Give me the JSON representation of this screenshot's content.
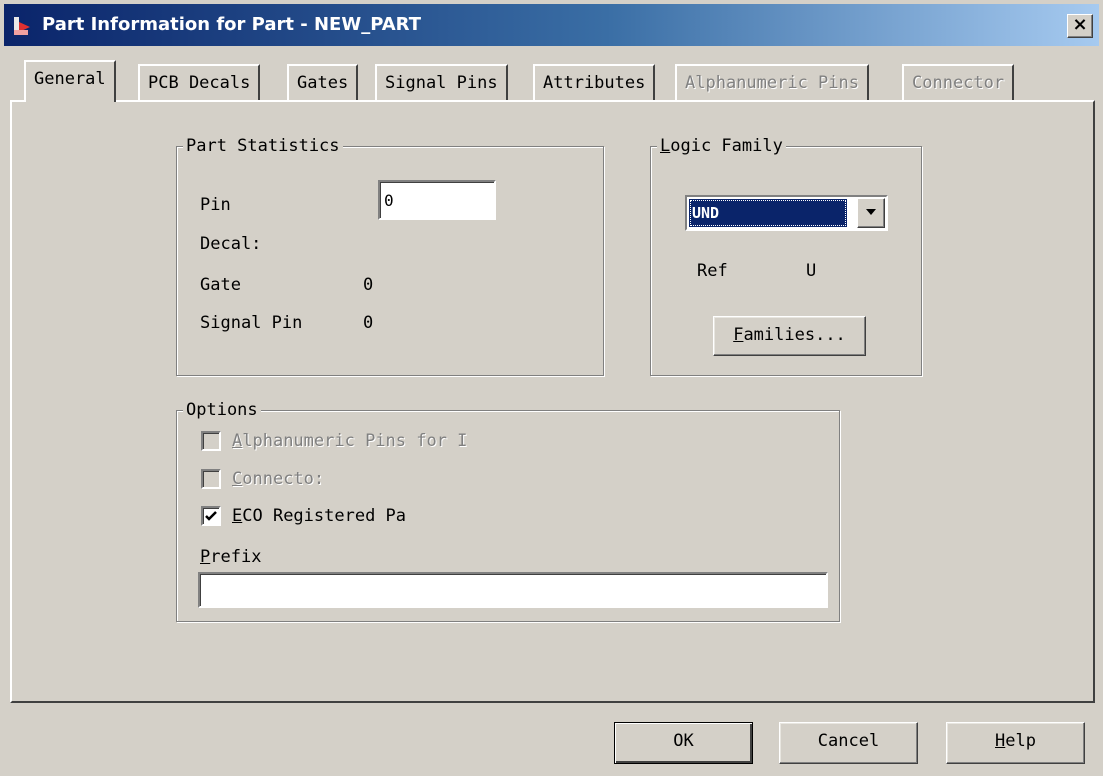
{
  "window": {
    "title": "Part Information for Part - NEW_PART",
    "close_label": "×"
  },
  "tabs": [
    {
      "label": "General",
      "state": "active"
    },
    {
      "label": "PCB Decals",
      "state": "enabled"
    },
    {
      "label": "Gates",
      "state": "enabled"
    },
    {
      "label": "Signal Pins",
      "state": "enabled"
    },
    {
      "label": "Attributes",
      "state": "enabled"
    },
    {
      "label": "Alphanumeric Pins",
      "state": "disabled"
    },
    {
      "label": "Connector",
      "state": "disabled"
    }
  ],
  "part_statistics": {
    "title": "Part Statistics",
    "pin_label": "Pin",
    "pin_value": "0",
    "decal_label": "Decal:",
    "gate_label": "Gate",
    "gate_value": "0",
    "signal_pin_label": "Signal Pin",
    "signal_pin_value": "0"
  },
  "logic_family": {
    "title_first": "L",
    "title_rest": "ogic Family",
    "selected": "UND",
    "ref_label": "Ref",
    "ref_value": "U",
    "families_button_first": "F",
    "families_button_rest": "amilies..."
  },
  "options": {
    "title": "Options",
    "alpha_first": "A",
    "alpha_rest": "lphanumeric Pins for I",
    "alpha_checked": false,
    "connector_first": "C",
    "connector_rest": "onnecto:",
    "connector_checked": false,
    "eco_first": "E",
    "eco_rest": "CO Registered Pa",
    "eco_checked": true,
    "prefix_first": "P",
    "prefix_rest": "refix",
    "prefix_value": ""
  },
  "buttons": {
    "ok": "OK",
    "cancel": "Cancel",
    "help_first": "H",
    "help_rest": "elp"
  },
  "colors": {
    "face": "#d4d0c8",
    "titlebar_start": "#0a246a",
    "titlebar_end": "#a6caf0",
    "selection": "#0a246a"
  }
}
